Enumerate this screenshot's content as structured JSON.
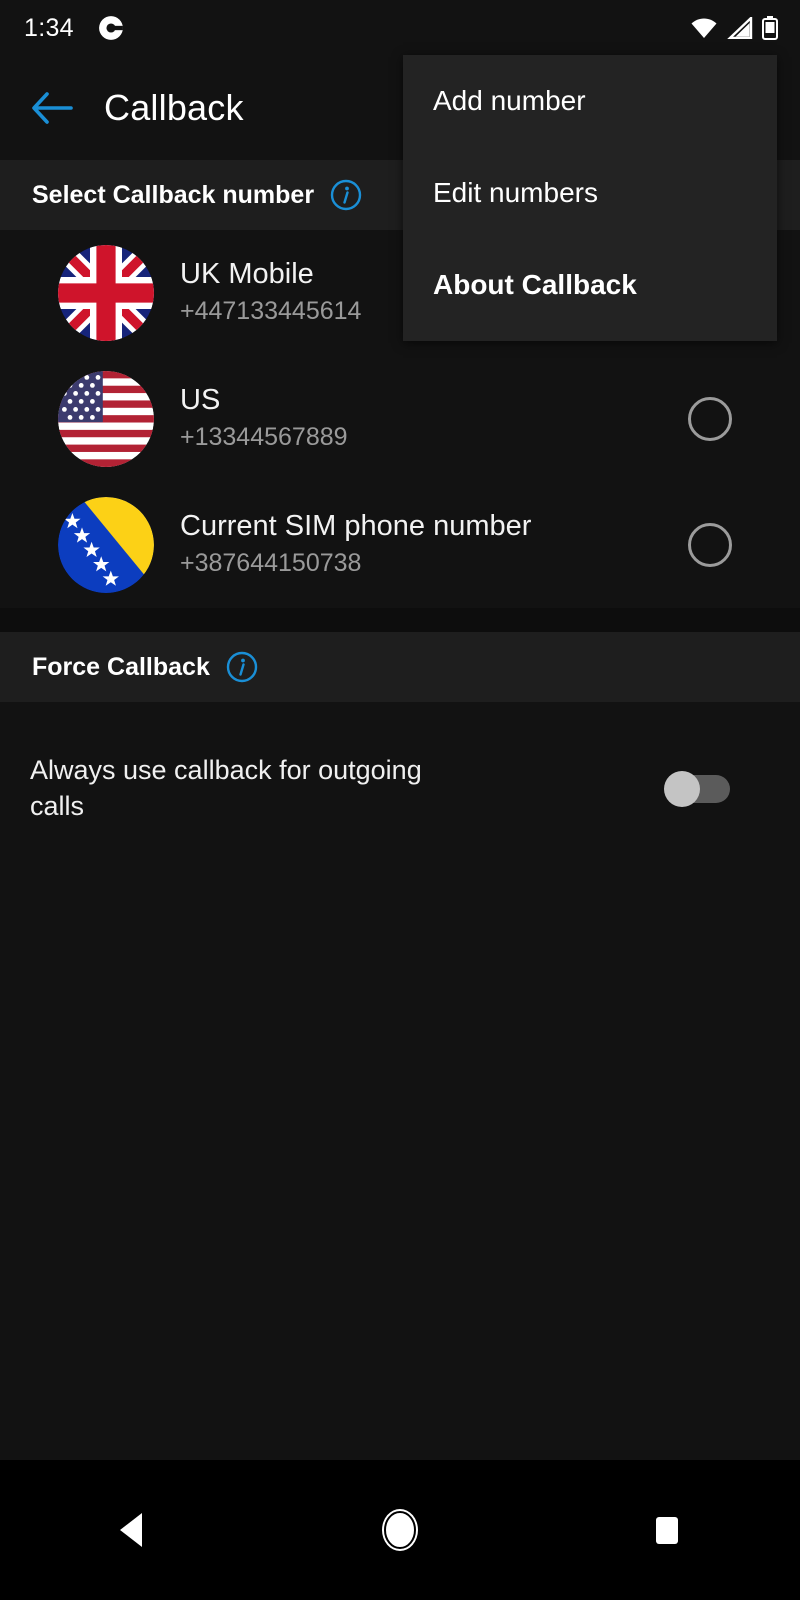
{
  "statusbar": {
    "time": "1:34",
    "notification_icon": "g-app-icon",
    "wifi_icon": "wifi-full-icon",
    "signal_icon": "cell-signal-icon",
    "battery_icon": "battery-icon"
  },
  "appbar": {
    "back_icon": "back-arrow-icon",
    "title": "Callback",
    "accent_color": "#1a8fd6"
  },
  "menu": {
    "items": [
      {
        "label": "Add number",
        "bold": false
      },
      {
        "label": "Edit numbers",
        "bold": false
      },
      {
        "label": "About Callback",
        "bold": true
      }
    ]
  },
  "select_section": {
    "header": "Select Callback number",
    "info_icon": "info-circle-icon",
    "numbers": [
      {
        "flag": "uk-flag-icon",
        "title": "UK Mobile",
        "number": "+447133445614",
        "selected": false,
        "radio_visible": false
      },
      {
        "flag": "us-flag-icon",
        "title": "US",
        "number": "+13344567889",
        "selected": false,
        "radio_visible": true
      },
      {
        "flag": "bosnia-flag-icon",
        "title": "Current SIM phone number",
        "number": "+387644150738",
        "selected": false,
        "radio_visible": true
      }
    ]
  },
  "force_section": {
    "header": "Force Callback",
    "info_icon": "info-circle-icon",
    "toggle_label": "Always use callback for outgoing calls",
    "toggle_on": false
  },
  "navbar": {
    "back": "nav-back-icon",
    "home": "nav-home-icon",
    "recents": "nav-recents-icon"
  }
}
